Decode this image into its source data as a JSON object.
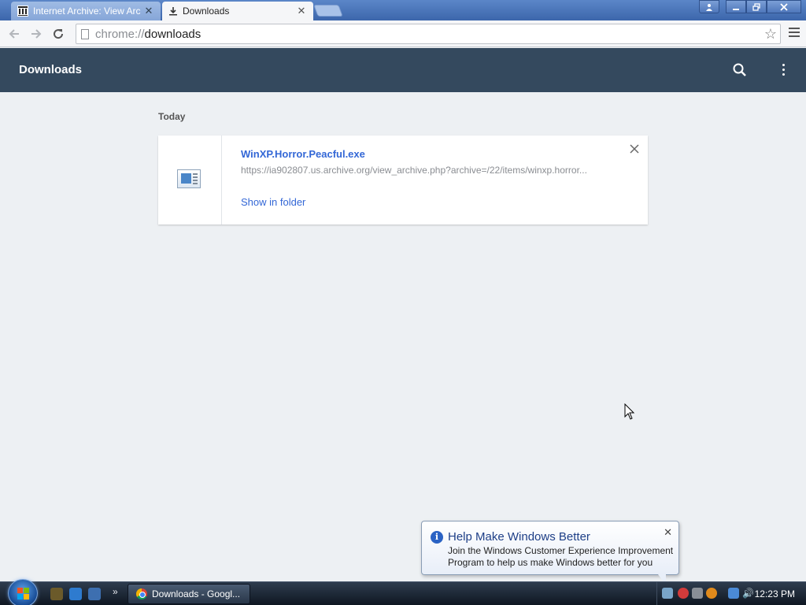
{
  "browser": {
    "tabs": [
      {
        "title": "Internet Archive: View Arc",
        "active": false
      },
      {
        "title": "Downloads",
        "active": true
      }
    ],
    "address": {
      "scheme": "chrome://",
      "path": "downloads"
    }
  },
  "header": {
    "title": "Downloads"
  },
  "downloads": {
    "section_label": "Today",
    "items": [
      {
        "file_name": "WinXP.Horror.Peacful.exe",
        "url": "https://ia902807.us.archive.org/view_archive.php?archive=/22/items/winxp.horror...",
        "action_label": "Show in folder"
      }
    ]
  },
  "notification": {
    "title": "Help Make Windows Better",
    "body": "Join the Windows Customer Experience Improvement Program to help us make Windows better for you"
  },
  "taskbar": {
    "task_label": "Downloads - Googl...",
    "clock": "12:23 PM"
  },
  "icons": {
    "window_profile": "person-icon",
    "window_minimize": "minimize-icon",
    "window_restore": "restore-icon",
    "window_close": "close-icon",
    "nav_back": "back-arrow-icon",
    "nav_forward": "forward-arrow-icon",
    "reload": "reload-icon",
    "bookmark": "star-icon",
    "search": "search-icon",
    "more": "more-vert-icon"
  },
  "colors": {
    "header_bg": "#34495e",
    "link": "#3367d6",
    "page_bg": "#edf0f3"
  }
}
